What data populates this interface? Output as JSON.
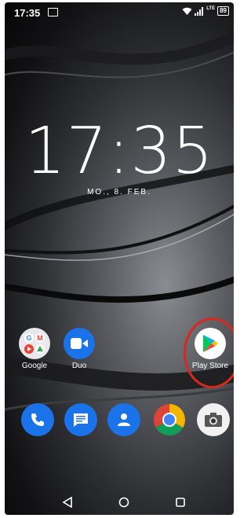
{
  "statusbar": {
    "time": "17:35",
    "network": "LTE",
    "battery": "89"
  },
  "lockclock": {
    "time": "17:35",
    "date": "MO., 8. FEB."
  },
  "apps": {
    "google": "Google",
    "duo": "Duo",
    "playstore": "Play Store"
  },
  "dock": [
    "phone-icon",
    "messages-icon",
    "contacts-icon",
    "chrome-icon",
    "camera-icon"
  ],
  "colors": {
    "highlight": "#d7291c",
    "app_blue": "#1a73e8"
  }
}
